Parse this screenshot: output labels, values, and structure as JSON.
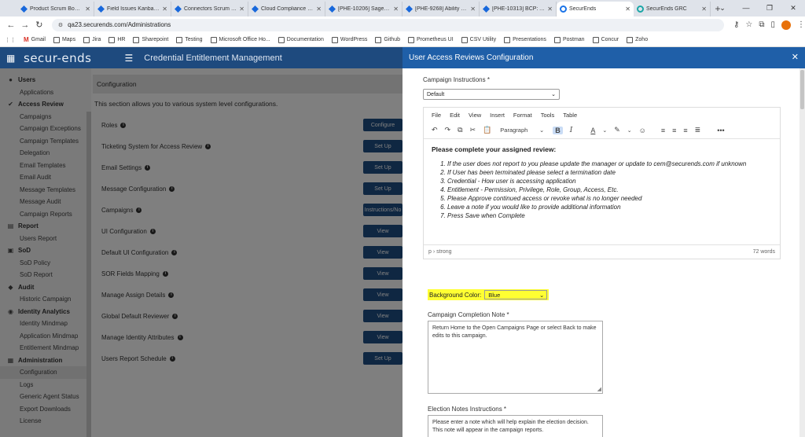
{
  "browser": {
    "tabs": [
      {
        "title": "Product Scrum Board -",
        "favicon": "jira",
        "active": false
      },
      {
        "title": "Field Issues Kanban Boa",
        "favicon": "jira",
        "active": false
      },
      {
        "title": "Connectors Scrum Boar",
        "favicon": "jira",
        "active": false
      },
      {
        "title": "Cloud Compliance - Ag",
        "favicon": "jira",
        "active": false
      },
      {
        "title": "[PHE-10206] Sagen - W",
        "favicon": "jira",
        "active": false
      },
      {
        "title": "[PHE-9268] Ability to cr",
        "favicon": "jira",
        "active": false
      },
      {
        "title": "[PHE-10313] BCP: Add S",
        "favicon": "jira",
        "active": false
      },
      {
        "title": "SecurEnds",
        "favicon": "se",
        "active": true
      },
      {
        "title": "SecurEnds GRC",
        "favicon": "sg",
        "active": false
      }
    ],
    "url": "qa23.securends.com/Administrations",
    "bookmarks": [
      "Gmail",
      "Maps",
      "Jira",
      "HR",
      "Sharepoint",
      "Testing",
      "Microsoft Office Ho...",
      "Documentation",
      "WordPress",
      "Github",
      "Prometheus UI",
      "CSV Utility",
      "Presentations",
      "Postman",
      "Concur",
      "Zoho"
    ]
  },
  "app": {
    "brand": "secur-ends",
    "title": "Credential Entitlement Management"
  },
  "sidebar": {
    "sections": [
      {
        "label": "Users",
        "icon": "user-icon",
        "glyph": "●",
        "items": [
          "Applications"
        ]
      },
      {
        "label": "Access Review",
        "icon": "check-icon",
        "glyph": "✔",
        "items": [
          "Campaigns",
          "Campaign Exceptions",
          "Campaign Templates",
          "Delegation",
          "Email Templates",
          "Email Audit",
          "Message Templates",
          "Message Audit",
          "Campaign Reports"
        ]
      },
      {
        "label": "Report",
        "icon": "report-icon",
        "glyph": "▤",
        "items": [
          "Users Report"
        ]
      },
      {
        "label": "SoD",
        "icon": "sod-icon",
        "glyph": "▣",
        "items": [
          "SoD Policy",
          "SoD Report"
        ]
      },
      {
        "label": "Audit",
        "icon": "audit-icon",
        "glyph": "◆",
        "items": [
          "Historic Campaign"
        ]
      },
      {
        "label": "Identity Analytics",
        "icon": "analytics-icon",
        "glyph": "◉",
        "items": [
          "Identity Mindmap",
          "Application Mindmap",
          "Entitlement Mindmap"
        ]
      },
      {
        "label": "Administration",
        "icon": "admin-icon",
        "glyph": "▦",
        "items": [
          "Configuration",
          "Logs",
          "Generic Agent Status",
          "Export Downloads",
          "License"
        ]
      }
    ],
    "active_item": "Configuration"
  },
  "main": {
    "header": "Configuration",
    "description": "This section allows you to various system level configurations.",
    "rows": [
      {
        "label": "Roles",
        "button": "Configure"
      },
      {
        "label": "Ticketing System for Access Review",
        "button": "Set Up"
      },
      {
        "label": "Email Settings",
        "button": "Set Up"
      },
      {
        "label": "Message Configuration",
        "button": "Set Up"
      },
      {
        "label": "Campaigns",
        "button": "Instructions/No"
      },
      {
        "label": "UI Configuration",
        "button": "View"
      },
      {
        "label": "Default UI Configuration",
        "button": "View"
      },
      {
        "label": "SOR Fields Mapping",
        "button": "View"
      },
      {
        "label": "Manage Assign Details",
        "button": "View"
      },
      {
        "label": "Global Default Reviewer",
        "button": "View"
      },
      {
        "label": "Manage Identity Attributes",
        "button": "View"
      },
      {
        "label": "Users Report Schedule",
        "button": "Set Up"
      }
    ]
  },
  "modal": {
    "title": "User Access Reviews Configuration",
    "campaign_instructions_label": "Campaign Instructions *",
    "template_select": "Default",
    "editor": {
      "menu": [
        "File",
        "Edit",
        "View",
        "Insert",
        "Format",
        "Tools",
        "Table"
      ],
      "paragraph_style": "Paragraph",
      "heading": "Please complete your assigned review:",
      "items": [
        "If the user does not report to you please update the manager or update to cem@securends.com if unknown",
        "If User has been terminated please select a termination date",
        "Credential - How user is accessing application",
        "Entitlement - Permission, Privilege, Role, Group, Access, Etc.",
        "Please Approve continued access or revoke what is no longer needed",
        "Leave a note if you would like to provide additional information",
        "Press Save when Complete"
      ],
      "path": "p › strong",
      "word_count": "72 words"
    },
    "background_color_label": "Background Color:",
    "background_color_value": "Blue",
    "completion_note_label": "Campaign Completion Note *",
    "completion_note": "Return Home to the Open Campaigns Page or select Back to make edits to this campaign.",
    "election_notes_label": "Election Notes Instructions *",
    "election_notes": "Please enter a note which will help explain the election decision. This note will appear in the campaign reports."
  },
  "colors": {
    "app_header": "#1e4a7e",
    "modal_header": "#1f5fa8",
    "button": "#1f4e85",
    "highlight": "#ffff33"
  }
}
